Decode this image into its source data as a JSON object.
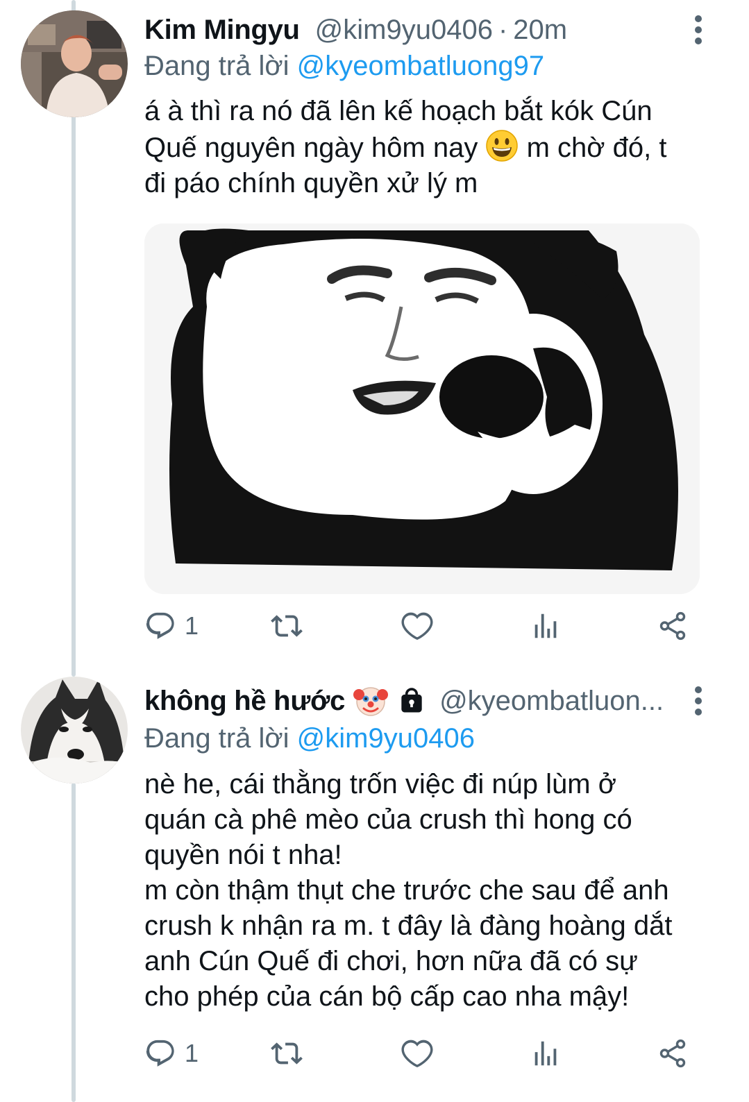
{
  "tweets": [
    {
      "display_name": "Kim Mingyu",
      "handle": "@kim9yu0406",
      "separator": "·",
      "time": "20m",
      "reply_prefix": "Đang trả lời",
      "reply_to": "@kyeombatluong97",
      "text_lines": [
        "á à thì ra nó đã lên kế hoạch bắt kók Cún",
        "Quế nguyên ngày hôm nay",
        " m chờ đó, t",
        "đi páo chính quyền xử lý m"
      ],
      "inline_emoji": "grinning-face",
      "has_media": true,
      "media_desc_icon": "panda-meme-image",
      "actions": {
        "reply_count": "1",
        "retweet_count": "",
        "like_count": ""
      }
    },
    {
      "display_name": "không hề hước",
      "name_emojis": [
        "clown-face",
        "lock"
      ],
      "handle": "@kyeombatluon...",
      "reply_prefix": "Đang trả lời",
      "reply_to": "@kim9yu0406",
      "text_lines": [
        "nè he, cái thằng trốn việc đi núp lùm ở",
        "quán cà phê mèo của crush thì hong có",
        "quyền nói t nha!",
        "m còn thậm thụt che trước che sau để anh",
        "crush k nhận ra m. t đây là đàng hoàng dắt",
        "anh Cún Quế đi chơi, hơn nữa đã có sự",
        "cho phép của cán bộ cấp cao nha mậy!"
      ],
      "actions": {
        "reply_count": "1",
        "retweet_count": "",
        "like_count": ""
      }
    }
  ],
  "colors": {
    "text": "#0f1419",
    "secondary": "#536471",
    "link": "#1d9bf0",
    "thread_line": "#cfd9de"
  }
}
